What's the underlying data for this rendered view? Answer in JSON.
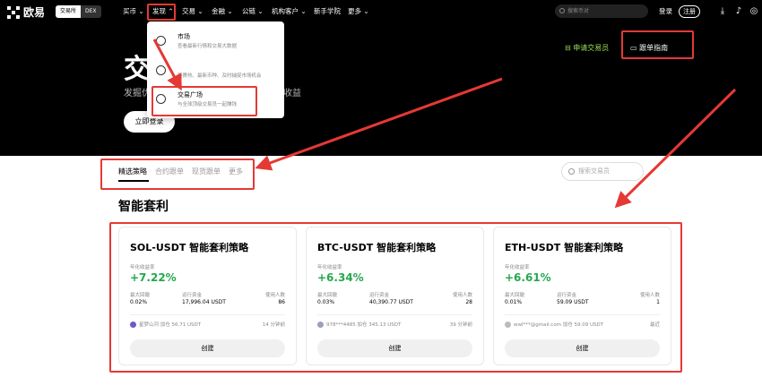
{
  "nav": {
    "logo": "欧易",
    "seg": [
      "交易所",
      "DEX"
    ],
    "items": [
      "买币",
      "发现",
      "交易",
      "金融",
      "公链",
      "机构客户",
      "新手学院",
      "更多"
    ],
    "search_placeholder": "搜索币对",
    "login": "登录",
    "register": "注册"
  },
  "hero": {
    "title": "交",
    "subtitle_a": "发掘优",
    "subtitle_b": "收益",
    "cta": "立即登录",
    "apply": "申请交易员",
    "guide": "跟单指南"
  },
  "dropdown": [
    {
      "title": "市场",
      "desc": "查看最新行情和交易大数据"
    },
    {
      "title": "",
      "desc": "新赛热、最新币种、及时捕捉市场机会"
    },
    {
      "title": "交易广场",
      "desc": "与全球顶级交易员一起赚钱"
    }
  ],
  "tabs": [
    "精选策略",
    "合约跟单",
    "现货跟单",
    "更多"
  ],
  "search2_placeholder": "搜索交易员",
  "section_title": "智能套利",
  "stat_labels": {
    "yield": "年化收益率",
    "drawdown": "最大回撤",
    "funds": "运行资金",
    "users": "使用人数"
  },
  "create_label": "创建",
  "cards": [
    {
      "title": "SOL-USDT 智能套利策略",
      "yield": "+7.22%",
      "drawdown": "0.02%",
      "funds": "17,996.04 USDT",
      "users": "86",
      "user": "星梦山河 加仓 56.71 USDT",
      "time": "14 分钟前"
    },
    {
      "title": "BTC-USDT 智能套利策略",
      "yield": "+6.34%",
      "drawdown": "0.03%",
      "funds": "40,390.77 USDT",
      "users": "28",
      "user": "978***4485 加仓 345.13 USDT",
      "time": "39 分钟前"
    },
    {
      "title": "ETH-USDT 智能套利策略",
      "yield": "+6.61%",
      "drawdown": "0.01%",
      "funds": "59.09 USDT",
      "users": "1",
      "user": "wwl***@gmail.com 加仓 59.09 USDT",
      "time": "最近"
    }
  ],
  "colors": {
    "accent_red": "#e53935",
    "yield_green": "#25a750",
    "apply_green": "#9be25a"
  }
}
